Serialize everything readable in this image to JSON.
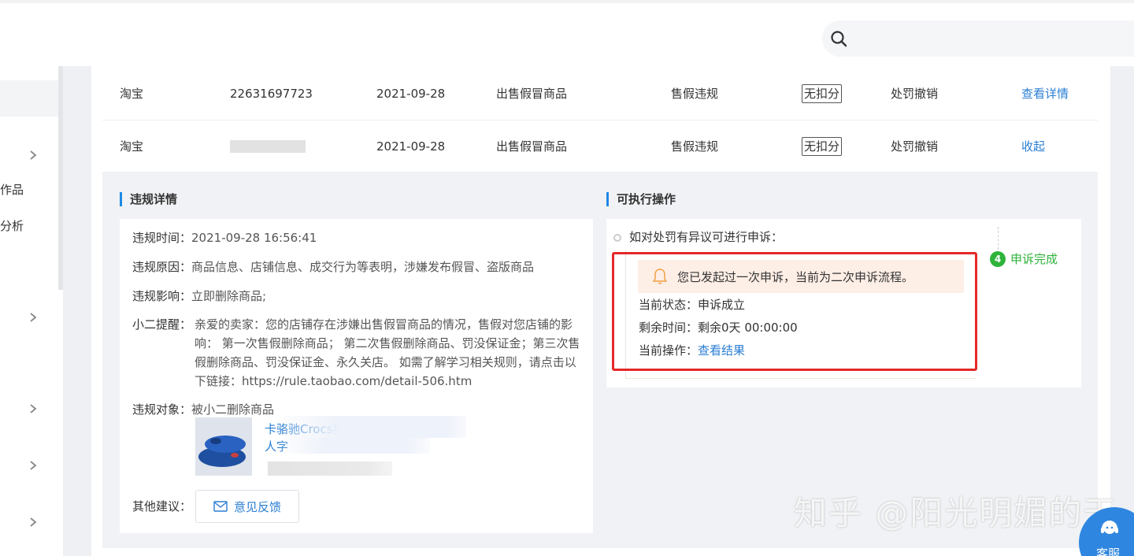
{
  "sidebar": {
    "items": [
      {
        "label": ""
      },
      {
        "label": ""
      },
      {
        "label": "作品"
      },
      {
        "label": "分析"
      }
    ]
  },
  "table": {
    "rows": [
      {
        "platform": "淘宝",
        "id": "22631697723",
        "date": "2021-09-28",
        "reason": "出售假冒商品",
        "type": "售假违规",
        "score": "无扣分",
        "result": "处罚撤销",
        "action": "查看详情"
      },
      {
        "platform": "淘宝",
        "id": "",
        "date": "2021-09-28",
        "reason": "出售假冒商品",
        "type": "售假违规",
        "score": "无扣分",
        "result": "处罚撤销",
        "action": "收起"
      }
    ]
  },
  "detail": {
    "title": "违规详情",
    "time_label": "违规时间：",
    "time_value": "2021-09-28 16:56:41",
    "cause_label": "违规原因：",
    "cause_value": "商品信息、店铺信息、成交行为等表明，涉嫌发布假冒、盗版商品",
    "impact_label": "违规影响：",
    "impact_value": "立即删除商品;",
    "reminder_label": "小二提醒：",
    "reminder_value": "亲爱的卖家：您的店铺存在涉嫌出售假冒商品的情况，售假对您店铺的影响： 第一次售假删除商品； 第二次售假删除商品、罚没保证金；第三次售假删除商品、罚没保证金、永久关店。 如需了解学习相关规则，请点击以下链接：https://rule.taobao.com/detail-506.htm",
    "object_label": "违规对象：",
    "object_value": "被小二删除商品",
    "product_line1": "卡骆驰Crocs男女",
    "product_line2": "人字",
    "suggest_label": "其他建议：",
    "feedback_label": "意见反馈"
  },
  "actions": {
    "title": "可执行操作",
    "timeline_text": "如对处罚有异议可进行申诉：",
    "notice": "您已发起过一次申诉，当前为二次申诉流程。",
    "status_label": "当前状态：",
    "status_value": "申诉成立",
    "remain_label": "剩余时间：",
    "remain_value": "剩余0天 00:00:00",
    "op_label": "当前操作：",
    "op_value": "查看结果",
    "step_num": "4",
    "step_label": "申诉完成"
  },
  "watermark": "知乎 @阳光明媚的天",
  "cs": {
    "label": "客服"
  },
  "colors": {
    "accent": "#2a7ed3",
    "success": "#2fb33b",
    "alert": "#e52828",
    "notice_bg": "#fdeee6"
  }
}
